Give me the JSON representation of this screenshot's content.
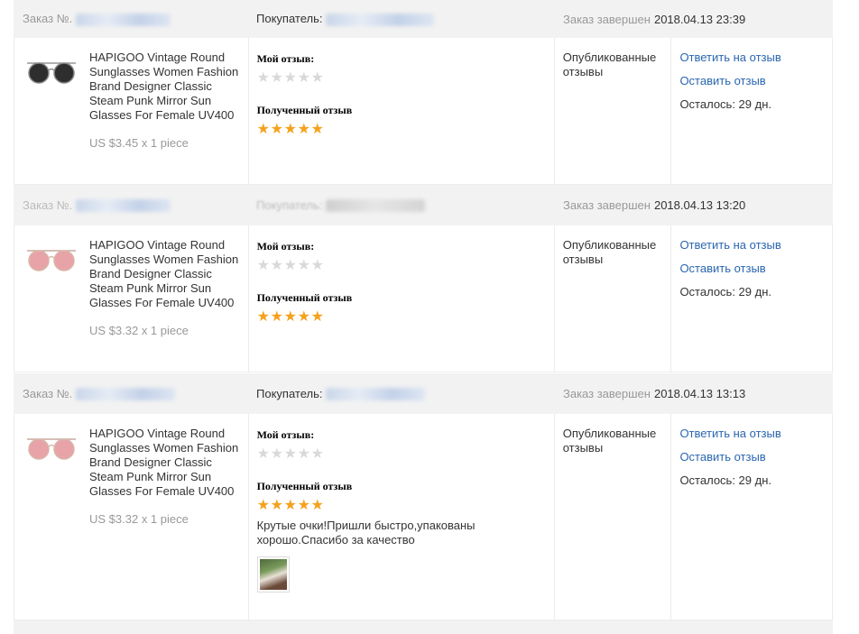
{
  "labels": {
    "order_prefix": "Заказ №.",
    "buyer_prefix": "Покупатель:",
    "completed": "Заказ завершен",
    "my_review": "Мой отзыв:",
    "received_review": "Полученный отзыв",
    "published": "Опубликованные отзывы",
    "reply_link": "Ответить на отзыв",
    "leave_link": "Оставить отзыв",
    "remaining": "Осталось: 29 дн."
  },
  "orders": [
    {
      "completed_at": "2018.04.13 23:39",
      "product_title": "HAPIGOO Vintage Round Sunglasses Women Fashion Brand Designer Classic Steam Punk Mirror Sun Glasses For Female UV400",
      "price": "US $3.45 x 1 piece",
      "lens_color": "#2e2e2e",
      "my_rating": 0,
      "received_rating": 5,
      "review_text": ""
    },
    {
      "completed_at": "2018.04.13 13:20",
      "product_title": "HAPIGOO Vintage Round Sunglasses Women Fashion Brand Designer Classic Steam Punk Mirror Sun Glasses For Female UV400",
      "price": "US $3.32 x 1 piece",
      "lens_color": "#e8a3a8",
      "my_rating": 0,
      "received_rating": 5,
      "review_text": ""
    },
    {
      "completed_at": "2018.04.13 13:13",
      "product_title": "HAPIGOO Vintage Round Sunglasses Women Fashion Brand Designer Classic Steam Punk Mirror Sun Glasses For Female UV400",
      "price": "US $3.32 x 1 piece",
      "lens_color": "#e8a3a8",
      "my_rating": 0,
      "received_rating": 5,
      "review_text": "Крутые очки!Пришли быстро,упакованы хорошо.Спасибо за качество"
    }
  ],
  "colors": {
    "link": "#2a66b0",
    "star_filled": "#f5a11c",
    "star_empty": "#d9d9d9",
    "header_bg": "#f2f2f2"
  }
}
